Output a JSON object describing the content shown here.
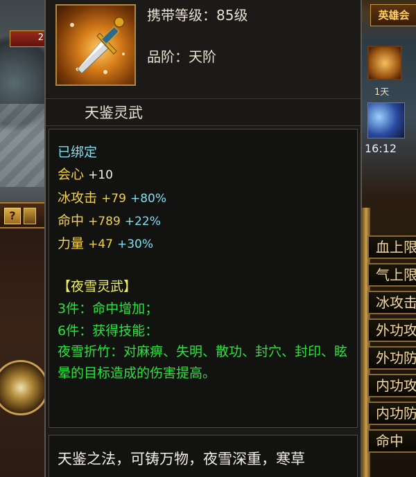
{
  "item": {
    "carry_level": "携带等级：85级",
    "grade": "品阶：天阶",
    "name": "天鉴灵武",
    "bound_status": "已绑定",
    "stats": [
      {
        "label": "会心",
        "value": "+10",
        "bonus": ""
      },
      {
        "label": "冰攻击",
        "value": "+79",
        "bonus": "+80%"
      },
      {
        "label": "命中",
        "value": "+789",
        "bonus": "+22%"
      },
      {
        "label": "力量",
        "value": "+47",
        "bonus": "+30%"
      }
    ],
    "set": {
      "title": "【夜雪灵武】",
      "piece3_label": "3件：",
      "piece3_effect": "命中增加；",
      "piece6_label": "6件：",
      "piece6_effect": "获得技能：",
      "skill_text": "夜雪折竹：对麻痹、失明、散功、封穴、封印、眩晕的目标造成的伤害提高。"
    },
    "description": "天鉴之法，可铸万物，夜雪深重，寒草"
  },
  "background": {
    "hp_value": "2",
    "right_banner": "英雄会",
    "chest_label": "1天",
    "clock": "16:12",
    "side_tabs": [
      "血上限",
      "气上限",
      "冰攻击",
      "外功攻",
      "外功防",
      "内功攻",
      "内功防",
      "命中"
    ],
    "help_icon": "?"
  },
  "colors": {
    "bound": "#7fe0f0",
    "stat_label": "#f2d24a",
    "stat_bonus": "#7fe0f0",
    "set_green": "#27e63a",
    "panel_bg": "#121210"
  }
}
